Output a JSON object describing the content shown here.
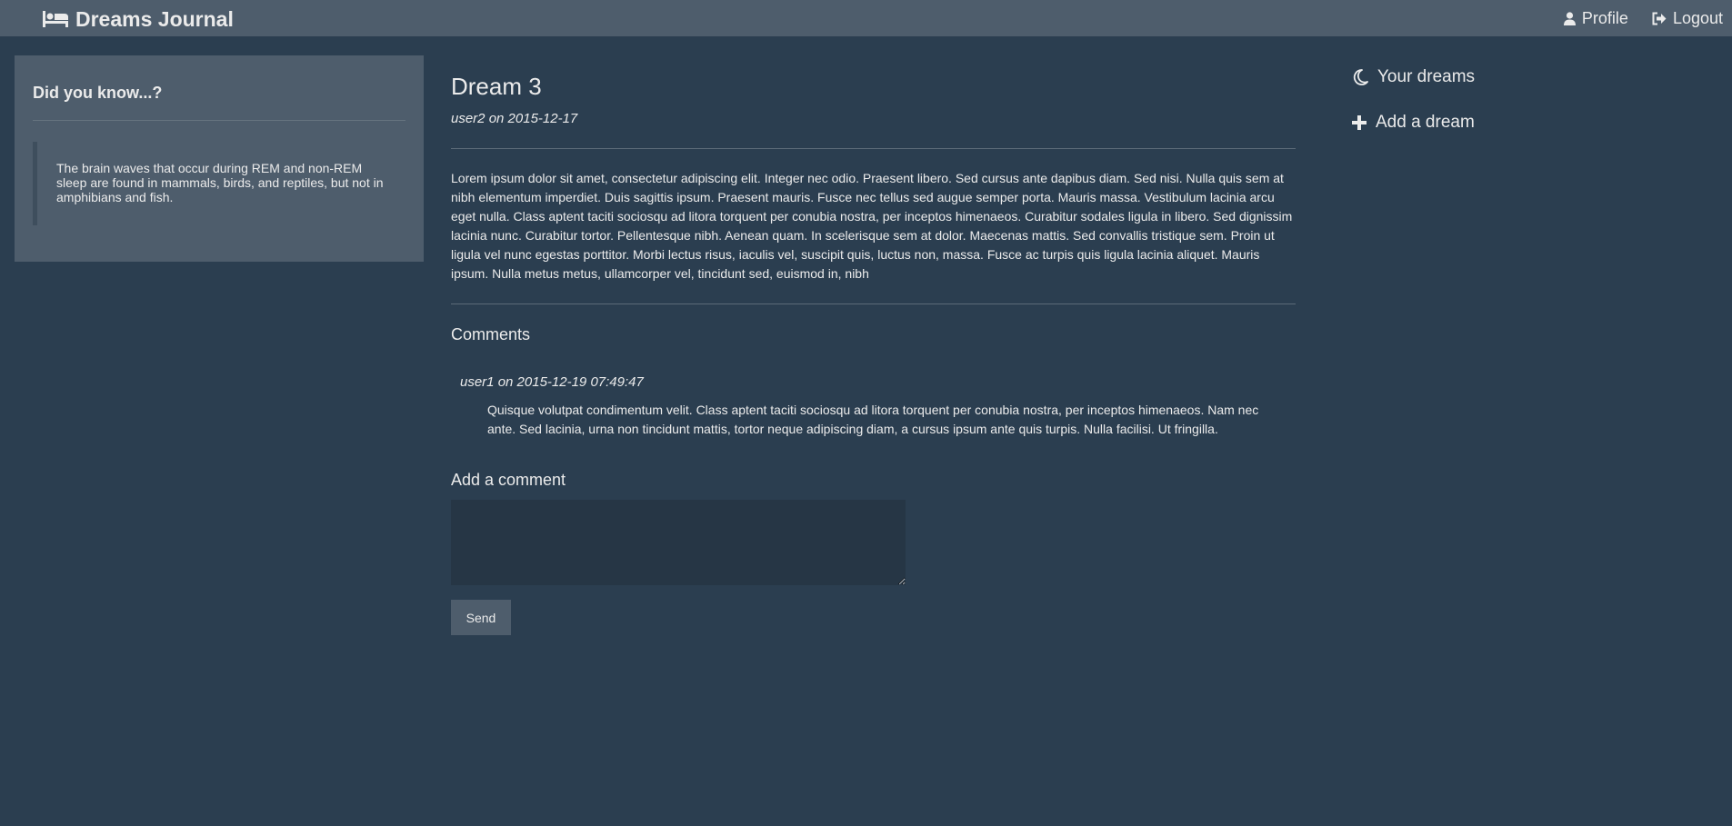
{
  "navbar": {
    "brand": "Dreams Journal",
    "brand_icon": "bed-icon",
    "profile_label": "Profile",
    "profile_icon": "user-icon",
    "logout_label": "Logout",
    "logout_icon": "logout-icon"
  },
  "sidebar": {
    "title": "Did you know...?",
    "fact": "The brain waves that occur during REM and non-REM sleep are found in mammals, birds, and reptiles, but not in amphibians and fish."
  },
  "dream": {
    "title": "Dream 3",
    "meta": "user2 on 2015-12-17",
    "body": "Lorem ipsum dolor sit amet, consectetur adipiscing elit. Integer nec odio. Praesent libero. Sed cursus ante dapibus diam. Sed nisi. Nulla quis sem at nibh elementum imperdiet. Duis sagittis ipsum. Praesent mauris. Fusce nec tellus sed augue semper porta. Mauris massa. Vestibulum lacinia arcu eget nulla. Class aptent taciti sociosqu ad litora torquent per conubia nostra, per inceptos himenaeos. Curabitur sodales ligula in libero. Sed dignissim lacinia nunc. Curabitur tortor. Pellentesque nibh. Aenean quam. In scelerisque sem at dolor. Maecenas mattis. Sed convallis tristique sem. Proin ut ligula vel nunc egestas porttitor. Morbi lectus risus, iaculis vel, suscipit quis, luctus non, massa. Fusce ac turpis quis ligula lacinia aliquet. Mauris ipsum. Nulla metus metus, ullamcorper vel, tincidunt sed, euismod in, nibh"
  },
  "comments": {
    "heading": "Comments",
    "items": [
      {
        "meta": "user1 on 2015-12-19 07:49:47",
        "text": "Quisque volutpat condimentum velit. Class aptent taciti sociosqu ad litora torquent per conubia nostra, per inceptos himenaeos. Nam nec ante. Sed lacinia, urna non tincidunt mattis, tortor neque adipiscing diam, a cursus ipsum ante quis turpis. Nulla facilisi. Ut fringilla."
      }
    ]
  },
  "add_comment": {
    "heading": "Add a comment",
    "input_value": "",
    "send_label": "Send"
  },
  "right_nav": {
    "items": [
      {
        "label": "Your dreams",
        "icon": "moon-icon"
      },
      {
        "label": "Add a dream",
        "icon": "plus-icon"
      }
    ]
  },
  "colors": {
    "background": "#2b3e50",
    "navbar": "#4e5d6c",
    "panel": "#4e5d6c",
    "input": "#263645",
    "text": "#ebebeb"
  }
}
